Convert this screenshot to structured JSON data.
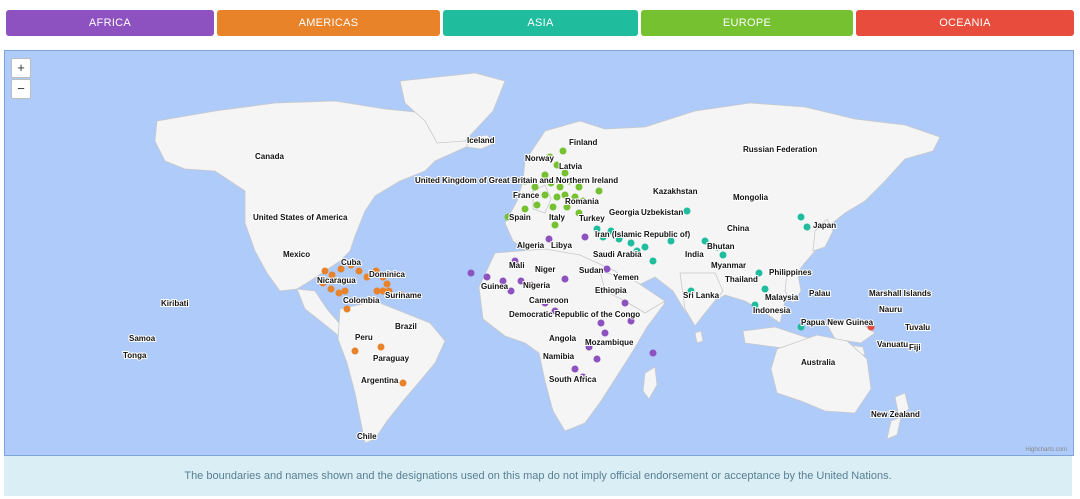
{
  "tabs": [
    {
      "label": "AFRICA",
      "color": "#8e52c0"
    },
    {
      "label": "AMERICAS",
      "color": "#e8832a"
    },
    {
      "label": "ASIA",
      "color": "#1fbd9e"
    },
    {
      "label": "EUROPE",
      "color": "#75c130"
    },
    {
      "label": "OCEANIA",
      "color": "#e74c3c"
    }
  ],
  "map": {
    "zoom_in": "+",
    "zoom_out": "−",
    "credits": "Highcharts.com",
    "ocean_color": "#aecbfa",
    "land_color": "#f5f5f5",
    "country_labels": [
      "Canada",
      "United States of America",
      "Mexico",
      "Cuba",
      "Dominica",
      "Nicaragua",
      "Colombia",
      "Suriname",
      "Brazil",
      "Peru",
      "Paraguay",
      "Argentina",
      "Chile",
      "Kiribati",
      "Samoa",
      "Tonga",
      "Iceland",
      "Finland",
      "Norway",
      "Latvia",
      "United Kingdom of Great Britain and Northern Ireland",
      "France",
      "Romania",
      "Spain",
      "Italy",
      "Turkey",
      "Georgia",
      "Uzbekistan",
      "Kazakhstan",
      "Mongolia",
      "Russian Federation",
      "China",
      "Japan",
      "Algeria",
      "Libya",
      "Iran (Islamic Republic of)",
      "Saudi Arabia",
      "Bhutan",
      "India",
      "Myanmar",
      "Mali",
      "Niger",
      "Sudan",
      "Yemen",
      "Guinea",
      "Nigeria",
      "Ethiopia",
      "Cameroon",
      "Democratic Republic of the Congo",
      "Angola",
      "Mozambique",
      "Namibia",
      "South Africa",
      "Sri Lanka",
      "Thailand",
      "Philippines",
      "Malaysia",
      "Indonesia",
      "Palau",
      "Papua New Guinea",
      "Marshall Islands",
      "Nauru",
      "Tuvalu",
      "Vanuatu",
      "Fiji",
      "Australia",
      "New Zealand"
    ]
  },
  "disclaimer": "The boundaries and names shown and the designations used on this map do not imply official endorsement or acceptance by the United Nations."
}
